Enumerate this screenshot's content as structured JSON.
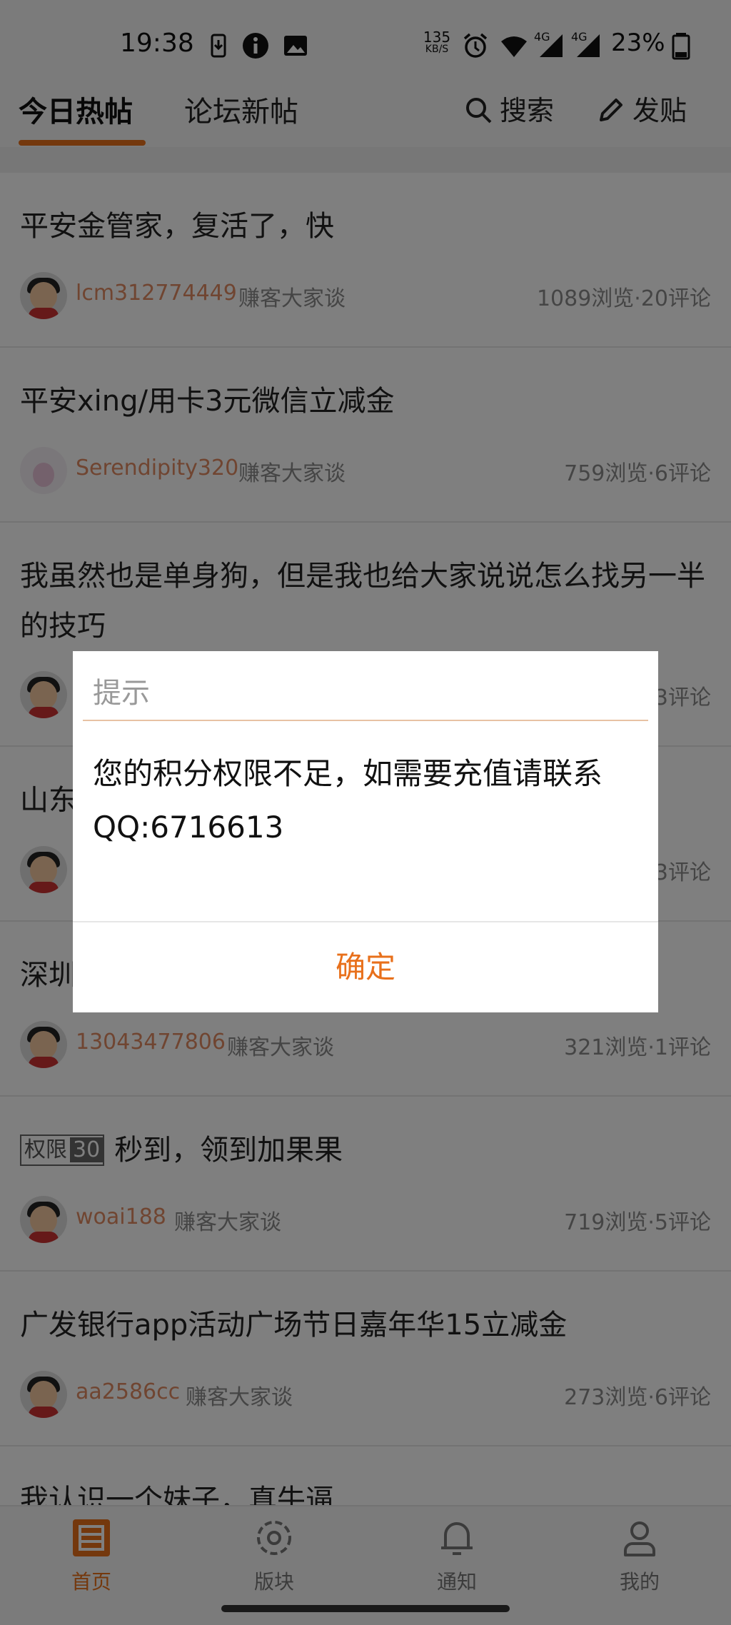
{
  "status_bar": {
    "time": "19:38",
    "net_speed_value": "135",
    "net_speed_unit": "KB/S",
    "network_1": "4G",
    "network_2": "4G",
    "battery": "23%"
  },
  "top_nav": {
    "tabs": [
      {
        "label": "今日热帖",
        "active": true
      },
      {
        "label": "论坛新帖",
        "active": false
      }
    ],
    "search_label": "搜索",
    "post_label": "发贴",
    "accent_color": "#e8701b"
  },
  "posts": [
    {
      "title": "平安金管家，复活了，快",
      "author": "lcm312774449",
      "board": "赚客大家谈",
      "stats": "1089浏览·20评论"
    },
    {
      "title": "平安xing/用卡3元微信立减金",
      "author": "Serendipity320",
      "board": "赚客大家谈",
      "stats": "759浏览·6评论"
    },
    {
      "title": "我虽然也是单身狗，但是我也给大家说说怎么找另一半的技巧",
      "author": "",
      "board": "",
      "stats": "3评论"
    },
    {
      "title": "山东",
      "author": "",
      "board": "",
      "stats": "3评论"
    },
    {
      "title": "深圳",
      "author": "13043477806",
      "board": "赚客大家谈",
      "stats": "321浏览·1评论"
    },
    {
      "title": "秒到，领到加果果",
      "badge_label": "权限",
      "badge_num": "30",
      "author": "woai188",
      "board": "赚客大家谈",
      "stats": "719浏览·5评论"
    },
    {
      "title": "广发银行app活动广场节日嘉年华15立减金",
      "author": "aa2586cc",
      "board": "赚客大家谈",
      "stats": "273浏览·6评论"
    },
    {
      "title": "我认识一个妹子，真牛逼"
    }
  ],
  "bottom_nav": {
    "items": [
      {
        "label": "首页",
        "icon": "home-icon",
        "active": true
      },
      {
        "label": "版块",
        "icon": "boards-icon",
        "active": false
      },
      {
        "label": "通知",
        "icon": "bell-icon",
        "active": false
      },
      {
        "label": "我的",
        "icon": "profile-icon",
        "active": false
      }
    ]
  },
  "dialog": {
    "title": "提示",
    "message": "您的积分权限不足，如需要充值请联系QQ:6716613",
    "confirm_label": "确定"
  }
}
